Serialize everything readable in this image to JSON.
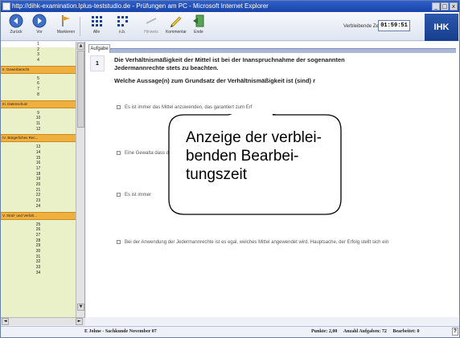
{
  "window": {
    "title": "http://dihk-examination.lplus-teststudio.de - Prüfungen am PC - Microsoft Internet Explorer",
    "minimize_label": "_",
    "maximize_label": "□",
    "close_label": "x"
  },
  "toolbar": {
    "buttons": [
      {
        "label": "Zurück",
        "icon": "back-arrow-icon"
      },
      {
        "label": "Vor",
        "icon": "forward-arrow-icon"
      },
      {
        "label": "Markieren",
        "icon": "flag-icon"
      },
      {
        "label": "Alle",
        "icon": "grid-icon"
      },
      {
        "label": "n.b.",
        "icon": "grid-small-icon"
      },
      {
        "label": "Hinweis",
        "icon": "hint-icon"
      },
      {
        "label": "Kommentar",
        "icon": "pencil-icon"
      },
      {
        "label": "Ende",
        "icon": "exit-icon"
      }
    ],
    "timer_label": "Verbleibende Zeit:",
    "timer_value": "01:59:51",
    "logo": "IHK"
  },
  "sidebar": {
    "groups": [
      {
        "section": "",
        "questions": [
          "1",
          "2",
          "3",
          "4"
        ]
      },
      {
        "section": "II. Gewerberecht",
        "questions": [
          "5",
          "6",
          "7",
          "8"
        ]
      },
      {
        "section": "III. Datenschutz",
        "questions": [
          "9",
          "10",
          "11",
          "12"
        ]
      },
      {
        "section": "IV. Bürgerliches Rec...",
        "questions": [
          "13",
          "14",
          "15",
          "16",
          "17",
          "18",
          "19",
          "20",
          "21",
          "22",
          "23",
          "24"
        ]
      },
      {
        "section": "V. Straf- und Verfah...",
        "questions": [
          "25",
          "26",
          "27",
          "28",
          "29",
          "30",
          "31",
          "32",
          "33",
          "34"
        ]
      }
    ]
  },
  "main": {
    "tab_label": "Aufgabe",
    "question_number": "1",
    "question_text": "Die Verhältnismäßigkeit der Mittel ist bei der Inanspruchnahme der sogenannten Jedermannrechte stets zu beachten.",
    "question_prompt": "Welche Aussage(n) zum Grundsatz der Verhältnismäßigkeit ist (sind) r",
    "options": [
      "Es ist immer das Mittel anzuwenden, das garantiert zum Erf",
      "Eine Gewalta dass diese M",
      "Es ist immer",
      "Bei der Anwendung der Jedermannrechte ist es egal, welches Mittel angewendet wird. Hauptsache, der Erfolg stellt sich ein"
    ]
  },
  "callout": {
    "text": "Anzeige der verblei-benden Bearbei-tungszeit"
  },
  "statusbar": {
    "left": "E Johne - Sachkunde November 07",
    "points": "Punkte: 2,00",
    "tasks": "Anzahl Aufgaben: 72",
    "done": "Bearbeitet: 0",
    "help": "?"
  }
}
